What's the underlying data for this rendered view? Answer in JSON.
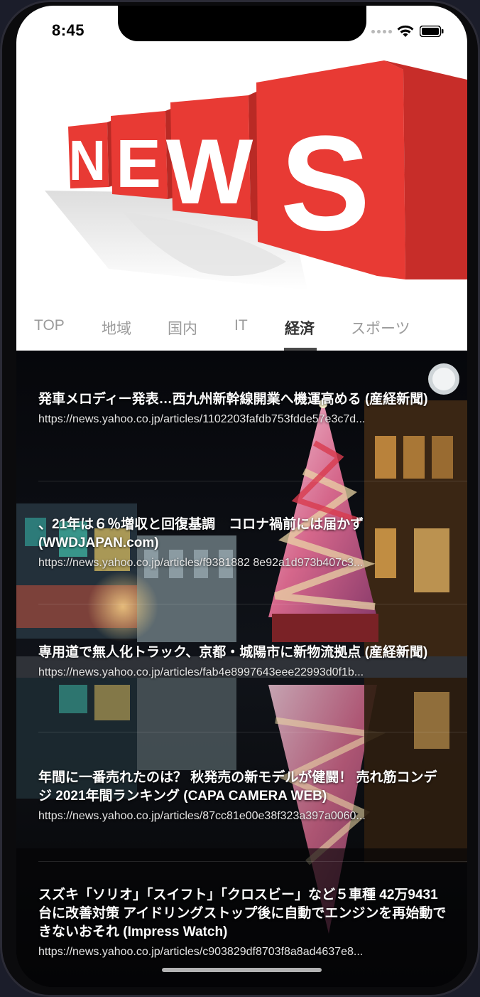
{
  "status_bar": {
    "time": "8:45"
  },
  "logo": {
    "text": "NEWS",
    "icon": "news-cube-logo",
    "color": "#e63232"
  },
  "tabs": [
    {
      "label": "TOP",
      "active": false
    },
    {
      "label": "地域",
      "active": false
    },
    {
      "label": "国内",
      "active": false
    },
    {
      "label": "IT",
      "active": false
    },
    {
      "label": "経済",
      "active": true
    },
    {
      "label": "スポーツ",
      "active": false
    }
  ],
  "articles": [
    {
      "title": "発車メロディー発表…西九州新幹線開業へ機運高める (産経新聞)",
      "url": "https://news.yahoo.co.jp/articles/1102203fafdb753fdde57e3c7d..."
    },
    {
      "title": "、21年は６％増収と回復基調　コロナ禍前には届かず (WWDJAPAN.com)",
      "url": "https://news.yahoo.co.jp/articles/f9381882 8e92a1d973b407c3..."
    },
    {
      "title": "専用道で無人化トラック、京都・城陽市に新物流拠点 (産経新聞)",
      "url": "https://news.yahoo.co.jp/articles/fab4e8997643eee22993d0f1b..."
    },
    {
      "title": "年間に一番売れたのは？ 秋発売の新モデルが健闘！ 売れ筋コンデジ 2021年間ランキング (CAPA CAMERA WEB)",
      "url": "https://news.yahoo.co.jp/articles/87cc81e00e38f323a397a0060..."
    },
    {
      "title": "スズキ「ソリオ」「スイフト」「クロスビー」など５車種 42万9431台に改善対策 アイドリングストップ後に自動でエンジンを再始動できないおそれ (Impress Watch)",
      "url": "https://news.yahoo.co.jp/articles/c903829df8703f8a8ad4637e8..."
    }
  ],
  "background_image": "christmas-tree-night-illumination",
  "colors": {
    "header_bg": "#ffffff",
    "tab_active": "#333333",
    "tab_inactive": "#9b9b9b",
    "title_text": "#ffffff"
  }
}
